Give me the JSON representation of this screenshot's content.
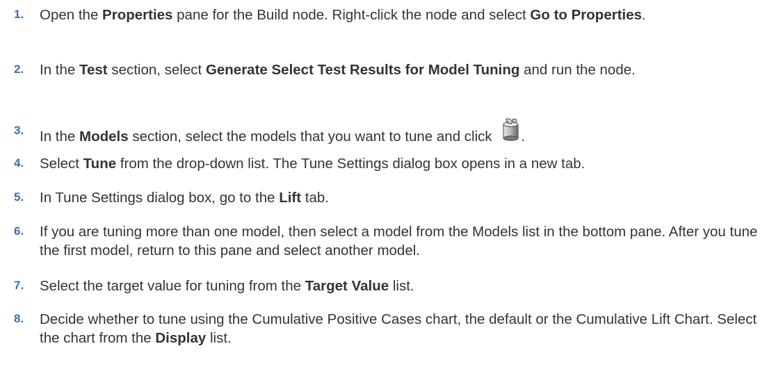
{
  "steps": [
    {
      "number": "1.",
      "parts": [
        {
          "t": "Open the ",
          "b": false
        },
        {
          "t": "Properties",
          "b": true
        },
        {
          "t": " pane for the Build node. Right-click the node and select ",
          "b": false
        },
        {
          "t": "Go to Properties",
          "b": true
        },
        {
          "t": ".",
          "b": false
        }
      ]
    },
    {
      "number": "2.",
      "parts": [
        {
          "t": "In the ",
          "b": false
        },
        {
          "t": "Test",
          "b": true
        },
        {
          "t": " section, select ",
          "b": false
        },
        {
          "t": "Generate Select Test Results for Model Tuning",
          "b": true
        },
        {
          "t": " and run the node.",
          "b": false
        }
      ]
    },
    {
      "number": "3.",
      "parts": [
        {
          "t": "In the ",
          "b": false
        },
        {
          "t": "Models",
          "b": true
        },
        {
          "t": " section, select the models that you want to tune and click ",
          "b": false
        }
      ],
      "icon": "action-icon",
      "after_icon": "."
    },
    {
      "number": "4.",
      "parts": [
        {
          "t": "Select ",
          "b": false
        },
        {
          "t": "Tune",
          "b": true
        },
        {
          "t": " from the drop-down list. The Tune Settings dialog box opens in a new tab.",
          "b": false
        }
      ]
    },
    {
      "number": "5.",
      "parts": [
        {
          "t": "In Tune Settings dialog box, go to the ",
          "b": false
        },
        {
          "t": "Lift",
          "b": true
        },
        {
          "t": " tab.",
          "b": false
        }
      ]
    },
    {
      "number": "6.",
      "parts": [
        {
          "t": "If you are tuning more than one model, then select a model from the Models list in the bottom pane. After you tune the first model, return to this pane and select another model.",
          "b": false
        }
      ]
    },
    {
      "number": "7.",
      "parts": [
        {
          "t": "Select the target value for tuning from the ",
          "b": false
        },
        {
          "t": "Target Value",
          "b": true
        },
        {
          "t": " list.",
          "b": false
        }
      ]
    },
    {
      "number": "8.",
      "parts": [
        {
          "t": "Decide whether to tune using the Cumulative Positive Cases chart, the default or the Cumulative Lift Chart. Select the chart from the ",
          "b": false
        },
        {
          "t": "Display",
          "b": true
        },
        {
          "t": " list.",
          "b": false
        }
      ]
    }
  ]
}
